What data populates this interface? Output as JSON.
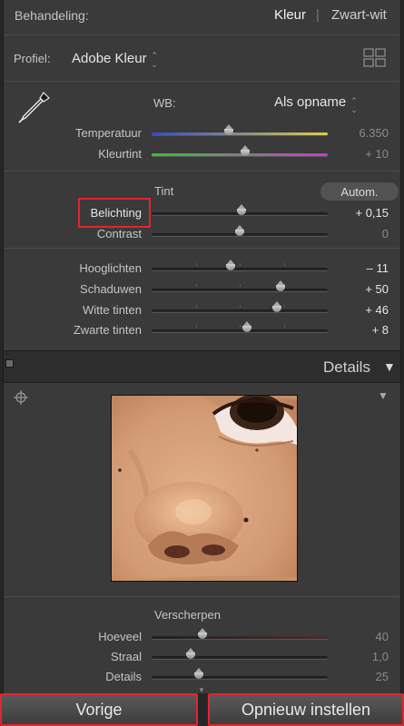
{
  "header": {
    "treatment_label": "Behandeling:",
    "color_option": "Kleur",
    "divider": "|",
    "bw_option": "Zwart-wit"
  },
  "profile": {
    "label": "Profiel:",
    "value": "Adobe Kleur",
    "chevron": "⌃⌄"
  },
  "wb": {
    "label": "WB:",
    "value": "Als opname",
    "sliders": [
      {
        "label": "Temperatuur",
        "value": "6.350",
        "position": 0.44
      },
      {
        "label": "Kleurtint",
        "value": "+ 10",
        "position": 0.53
      }
    ]
  },
  "tone": {
    "title": "Tint",
    "auto_label": "Autom.",
    "sliders": [
      {
        "label": "Belichting",
        "value": "+ 0,15",
        "position": 0.51
      },
      {
        "label": "Contrast",
        "value": "0",
        "position": 0.5
      }
    ],
    "sliders2": [
      {
        "label": "Hooglichten",
        "value": "– 11",
        "position": 0.45
      },
      {
        "label": "Schaduwen",
        "value": "+ 50",
        "position": 0.73
      },
      {
        "label": "Witte tinten",
        "value": "+ 46",
        "position": 0.71
      },
      {
        "label": "Zwarte tinten",
        "value": "+ 8",
        "position": 0.54
      }
    ]
  },
  "details": {
    "title": "Details",
    "collapse_icon": "▼",
    "sharpen_title": "Verscherpen",
    "sliders": [
      {
        "label": "Hoeveel",
        "value": "40",
        "position": 0.29
      },
      {
        "label": "Straal",
        "value": "1,0",
        "position": 0.22
      },
      {
        "label": "Details",
        "value": "25",
        "position": 0.27
      }
    ]
  },
  "buttons": {
    "previous": "Vorige",
    "reset": "Opnieuw instellen"
  },
  "colors": {
    "highlight_red": "#e0262e",
    "panel_bg": "#3a3a3a",
    "temperature_track": [
      "#3d4bd0",
      "#d8d050"
    ],
    "tint_track": [
      "#40c040",
      "#c040c0"
    ]
  }
}
